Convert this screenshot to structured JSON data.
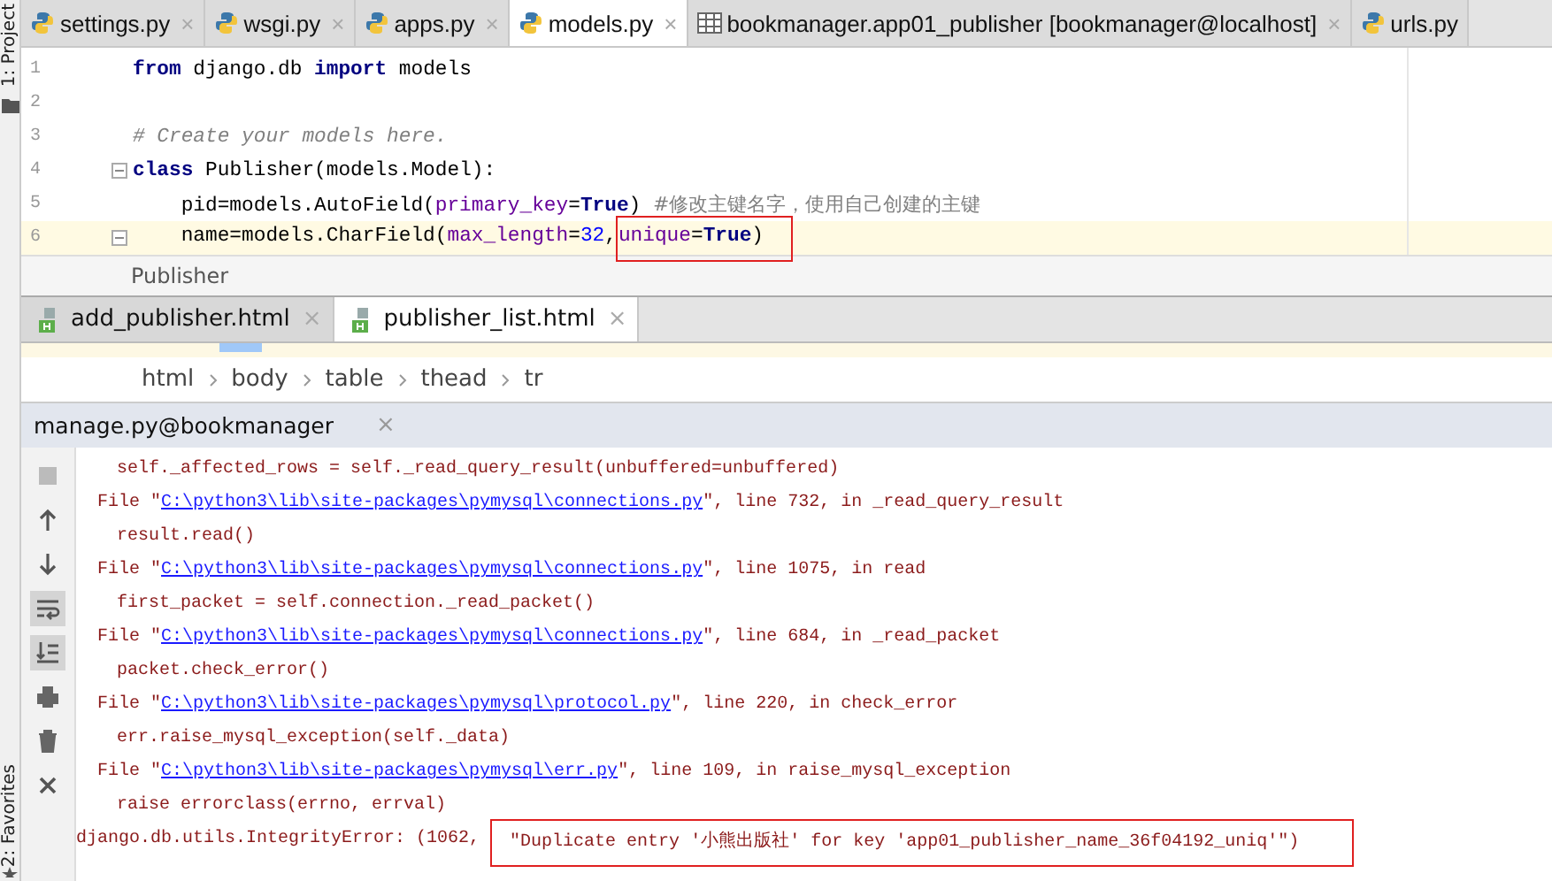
{
  "side_strip": {
    "top_label": "1: Project",
    "bottom_label": "2: Favorites"
  },
  "editor_tabs": [
    {
      "label": "settings.py",
      "kind": "python",
      "close": "×",
      "selected": false
    },
    {
      "label": "wsgi.py",
      "kind": "python",
      "close": "×",
      "selected": false
    },
    {
      "label": "apps.py",
      "kind": "python",
      "close": "×",
      "selected": false
    },
    {
      "label": "models.py",
      "kind": "python",
      "close": "×",
      "selected": true
    },
    {
      "label": "bookmanager.app01_publisher [bookmanager@localhost]",
      "kind": "table",
      "close": "×",
      "selected": false
    },
    {
      "label": "urls.py",
      "kind": "python",
      "selected": false
    }
  ],
  "code_lines": [
    {
      "number": "1",
      "current": false,
      "fold": false,
      "segments": [
        {
          "text": "from",
          "kind": "keyword"
        },
        {
          "text": " django.db ",
          "kind": "plain"
        },
        {
          "text": "import",
          "kind": "keyword"
        },
        {
          "text": " models",
          "kind": "plain"
        }
      ]
    },
    {
      "number": "2",
      "current": false,
      "fold": false
    },
    {
      "number": "3",
      "current": false,
      "fold": false,
      "segments": [
        {
          "text": "# Create your models here.",
          "kind": "comment"
        }
      ]
    },
    {
      "number": "4",
      "current": false,
      "fold": true,
      "segments": [
        {
          "text": "class",
          "kind": "keyword"
        },
        {
          "text": " Publisher(models.Model):",
          "kind": "plain"
        }
      ]
    },
    {
      "number": "5",
      "current": false,
      "fold": false,
      "segments": [
        {
          "text": "    pid=models.AutoField(",
          "kind": "plain"
        },
        {
          "text": "primary_key",
          "kind": "param"
        },
        {
          "text": "=",
          "kind": "plain"
        },
        {
          "text": "True",
          "kind": "keyword"
        },
        {
          "text": ") ",
          "kind": "plain"
        },
        {
          "text": "#修改主键名字，使用自己创建的主键",
          "kind": "comment_cjk"
        }
      ]
    },
    {
      "number": "6",
      "current": true,
      "fold": true,
      "segments": [
        {
          "text": "    name=models.CharField(",
          "kind": "plain"
        },
        {
          "text": "max_length",
          "kind": "param"
        },
        {
          "text": "=",
          "kind": "plain"
        },
        {
          "text": "32",
          "kind": "number"
        },
        {
          "text": ",",
          "kind": "plain"
        },
        {
          "text": "unique",
          "kind": "param",
          "boxed": true
        },
        {
          "text": "=",
          "kind": "plain",
          "boxed": true
        },
        {
          "text": "True",
          "kind": "keyword",
          "boxed": true
        },
        {
          "text": ")",
          "kind": "plain",
          "boxed": true
        }
      ]
    }
  ],
  "editor_breadcrumb": "Publisher",
  "html_tabs": [
    {
      "label": "add_publisher.html",
      "close": "×",
      "selected": false
    },
    {
      "label": "publisher_list.html",
      "close": "×",
      "selected": true
    }
  ],
  "html_breadcrumb": [
    "html",
    "body",
    "table",
    "thead",
    "tr"
  ],
  "run_panel": {
    "title": "manage.py@bookmanager",
    "close": "×",
    "toolbar": [
      {
        "kind": "stop",
        "active": false
      },
      {
        "kind": "up",
        "active": false
      },
      {
        "kind": "down",
        "active": false
      },
      {
        "kind": "wrap",
        "active": true
      },
      {
        "kind": "scroll-end",
        "active": true
      },
      {
        "kind": "print",
        "active": false
      },
      {
        "kind": "trash",
        "active": false
      },
      {
        "kind": "close",
        "active": false
      }
    ],
    "console": [
      {
        "kind": "code",
        "text": "self._affected_rows = self._read_query_result(unbuffered=unbuffered)"
      },
      {
        "kind": "file",
        "prefix": "File \"",
        "link": "C:\\python3\\lib\\site-packages\\pymysql\\connections.py",
        "suffix": "\", line 732, in _read_query_result"
      },
      {
        "kind": "code",
        "text": "result.read()"
      },
      {
        "kind": "file",
        "prefix": "File \"",
        "link": "C:\\python3\\lib\\site-packages\\pymysql\\connections.py",
        "suffix": "\", line 1075, in read"
      },
      {
        "kind": "code",
        "text": "first_packet = self.connection._read_packet()"
      },
      {
        "kind": "file",
        "prefix": "File \"",
        "link": "C:\\python3\\lib\\site-packages\\pymysql\\connections.py",
        "suffix": "\", line 684, in _read_packet"
      },
      {
        "kind": "code",
        "text": "packet.check_error()"
      },
      {
        "kind": "file",
        "prefix": "File \"",
        "link": "C:\\python3\\lib\\site-packages\\pymysql\\protocol.py",
        "suffix": "\", line 220, in check_error"
      },
      {
        "kind": "code",
        "text": "err.raise_mysql_exception(self._data)"
      },
      {
        "kind": "file",
        "prefix": "File \"",
        "link": "C:\\python3\\lib\\site-packages\\pymysql\\err.py",
        "suffix": "\", line 109, in raise_mysql_exception"
      },
      {
        "kind": "code",
        "text": "raise errorclass(errno, errval)"
      },
      {
        "kind": "error",
        "prefix": "django.db.utils.IntegrityError: (1062, ",
        "boxed": "\"Duplicate entry '小熊出版社' for key 'app01_publisher_name_36f04192_uniq'\")"
      }
    ]
  }
}
